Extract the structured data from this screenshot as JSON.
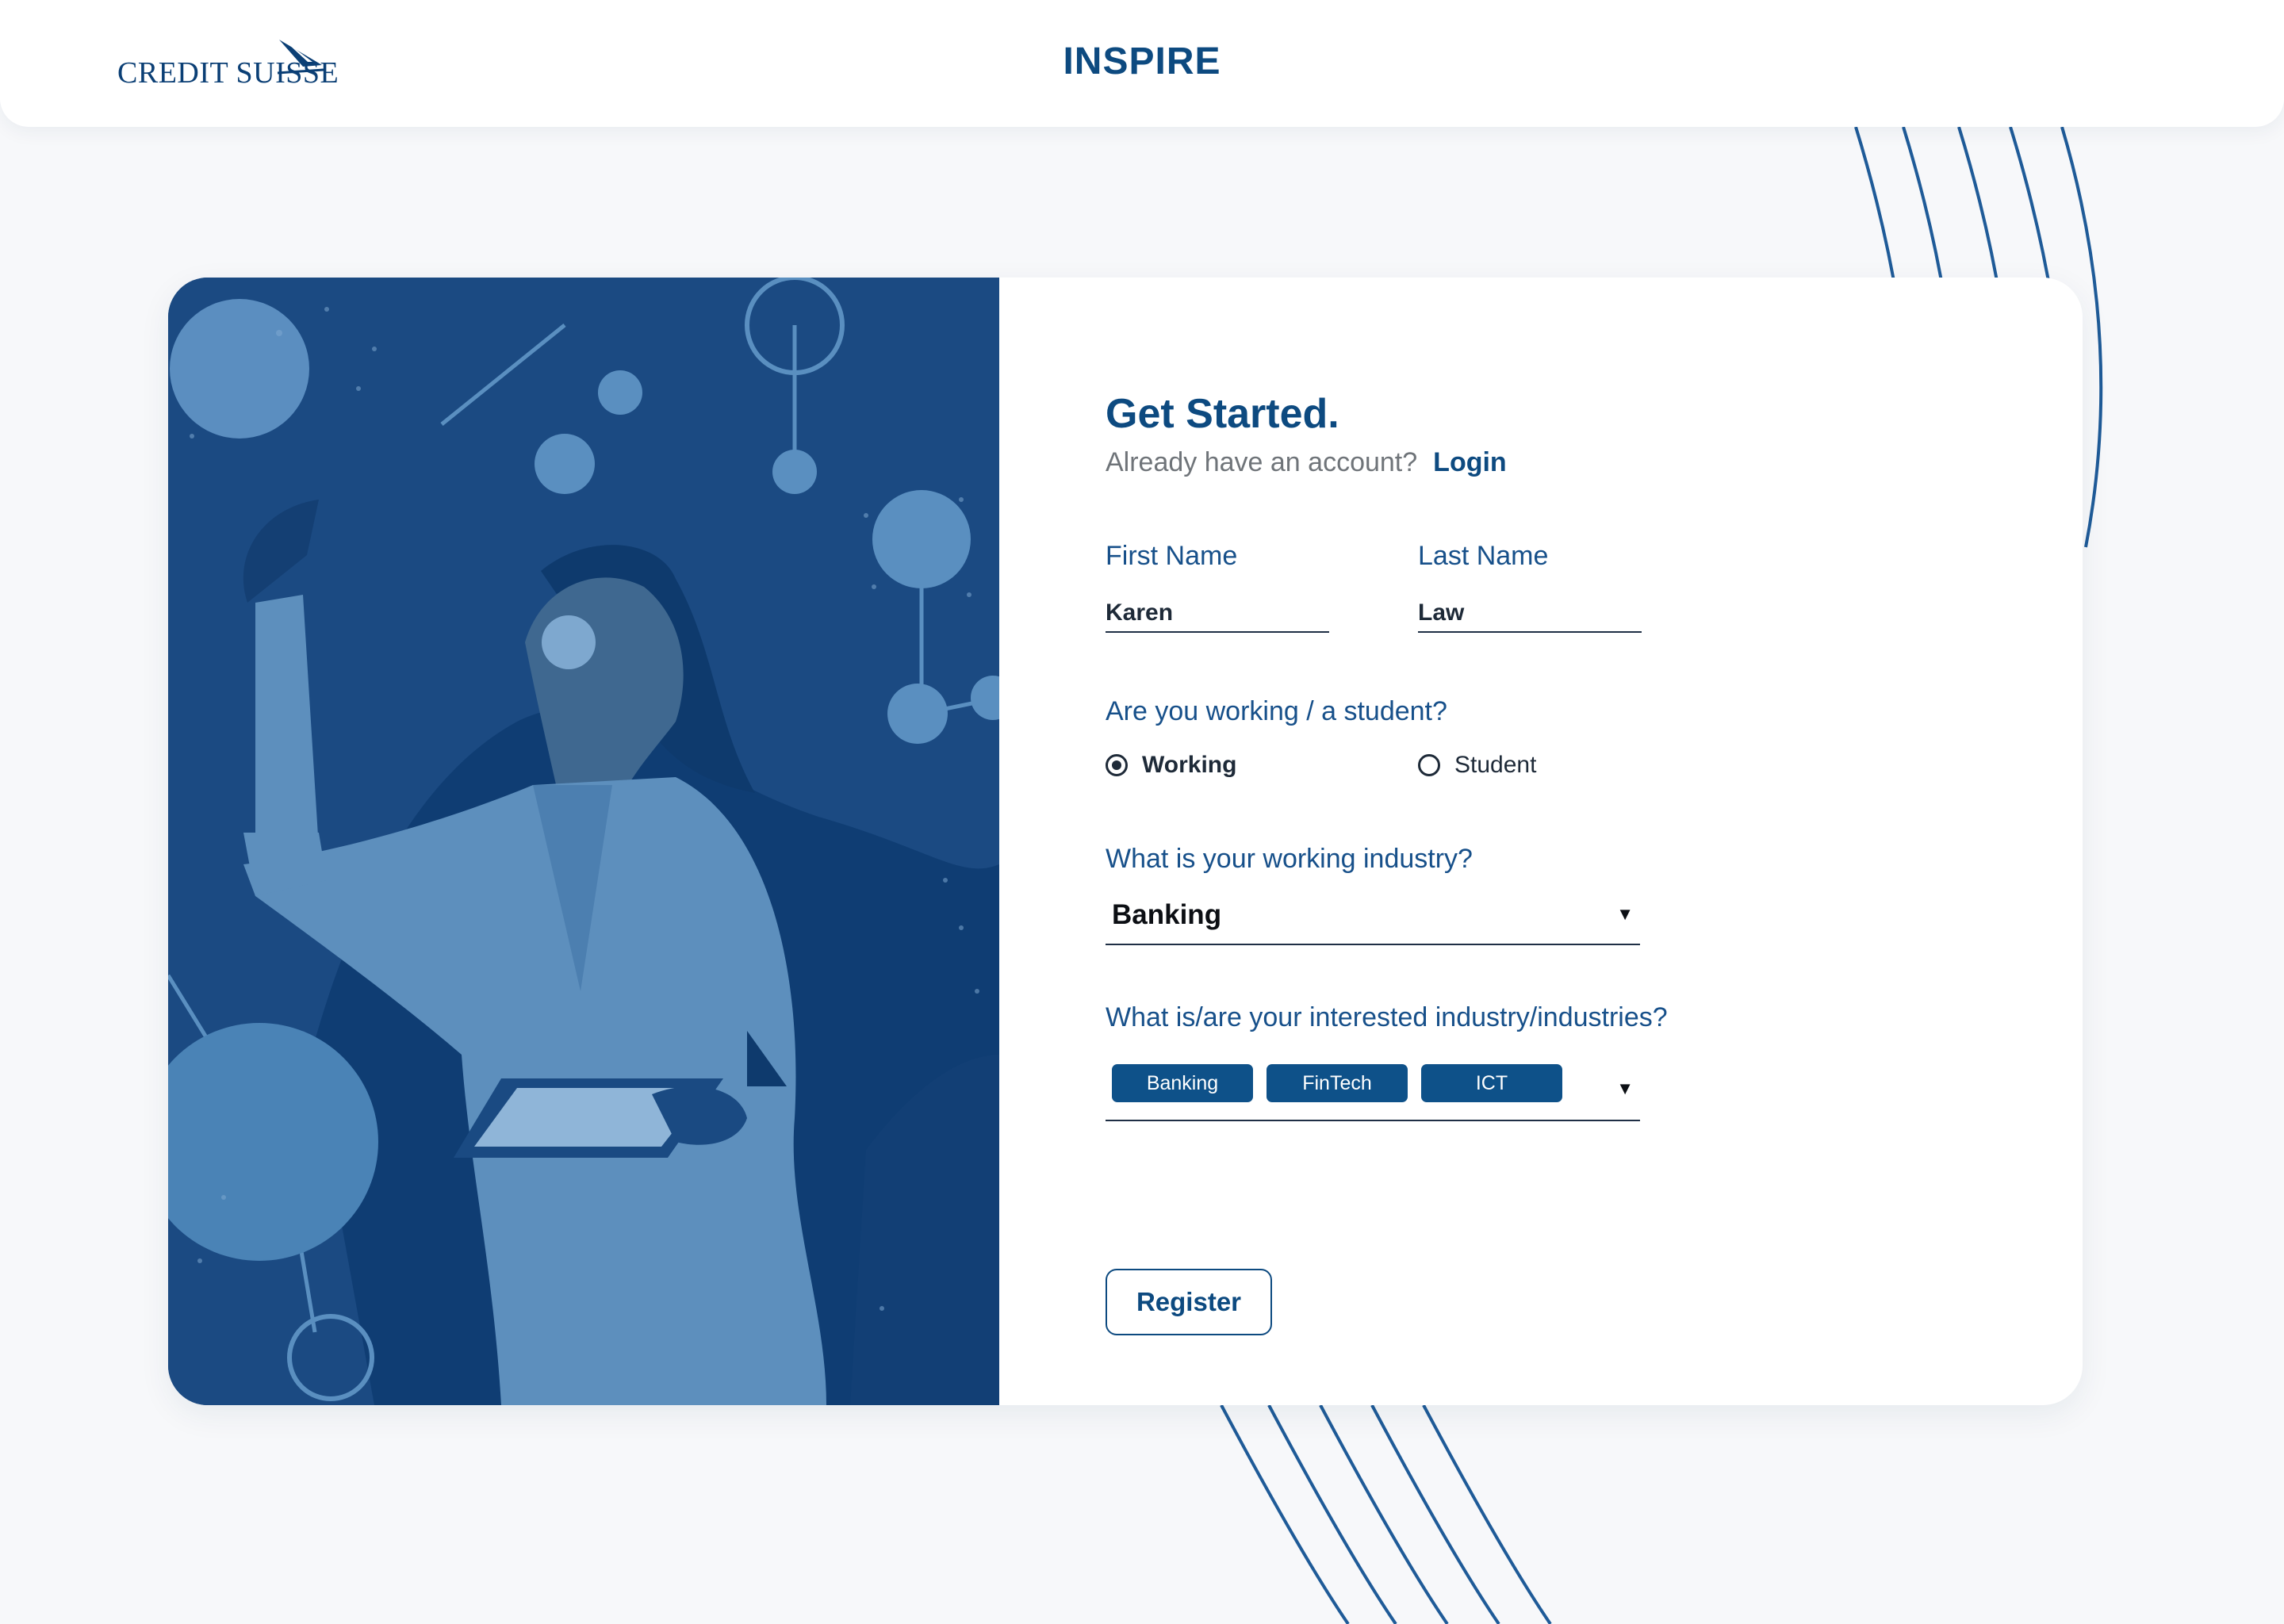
{
  "header": {
    "logo_text": "CREDIT SUISSE",
    "title": "INSPIRE"
  },
  "form": {
    "title": "Get Started.",
    "login_prompt": "Already have an account?",
    "login_link": "Login",
    "first_name": {
      "label": "First Name",
      "value": "Karen"
    },
    "last_name": {
      "label": "Last Name",
      "value": "Law"
    },
    "status_question": "Are you working / a student?",
    "status_options": [
      {
        "label": "Working",
        "selected": true
      },
      {
        "label": "Student",
        "selected": false
      }
    ],
    "industry_question": "What is your working industry?",
    "industry_value": "Banking",
    "interests_question": "What is/are your interested industry/industries?",
    "interests_tags": [
      "Banking",
      "FinTech",
      "ICT"
    ],
    "register_label": "Register"
  },
  "colors": {
    "primary": "#0d4a80",
    "illustration_bg": "#1b4a82",
    "page_bg": "#f7f8fa",
    "tag_bg": "#0e5189"
  },
  "icons": {
    "dropdown": "triangle-down-icon",
    "logo": "sail-icon"
  }
}
